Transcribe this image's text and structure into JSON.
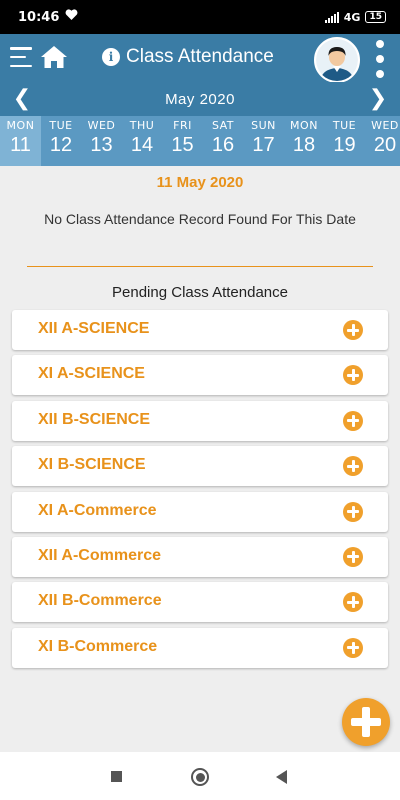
{
  "status_bar": {
    "time": "10:46",
    "network": "4G",
    "battery": "15"
  },
  "app_bar": {
    "title": "Class Attendance",
    "icons": [
      "menu-icon",
      "home-icon",
      "info-icon",
      "avatar",
      "more-vert-icon"
    ]
  },
  "calendar": {
    "month_label": "May 2020",
    "prev": "❮",
    "next": "❯",
    "days": [
      {
        "day": "MON",
        "date": "11",
        "selected": true
      },
      {
        "day": "TUE",
        "date": "12"
      },
      {
        "day": "WED",
        "date": "13"
      },
      {
        "day": "THU",
        "date": "14"
      },
      {
        "day": "FRI",
        "date": "15"
      },
      {
        "day": "SAT",
        "date": "16"
      },
      {
        "day": "SUN",
        "date": "17"
      },
      {
        "day": "MON",
        "date": "18"
      },
      {
        "day": "TUE",
        "date": "19"
      },
      {
        "day": "WED",
        "date": "20"
      }
    ]
  },
  "main": {
    "selected_date": "11 May 2020",
    "no_record_message": "No Class Attendance Record Found For This Date",
    "pending_title": "Pending Class Attendance",
    "classes": [
      "XII A-SCIENCE",
      "XI A-SCIENCE",
      "XII B-SCIENCE",
      "XI B-SCIENCE",
      "XI A-Commerce",
      "XII A-Commerce",
      "XII B-Commerce",
      "XI B-Commerce"
    ]
  },
  "colors": {
    "primary": "#3a7ca5",
    "date_strip": "#5b99c2",
    "selected_date_bg": "#7fb3d5",
    "accent": "#e8921b",
    "add_icon": "#f0a02c"
  }
}
